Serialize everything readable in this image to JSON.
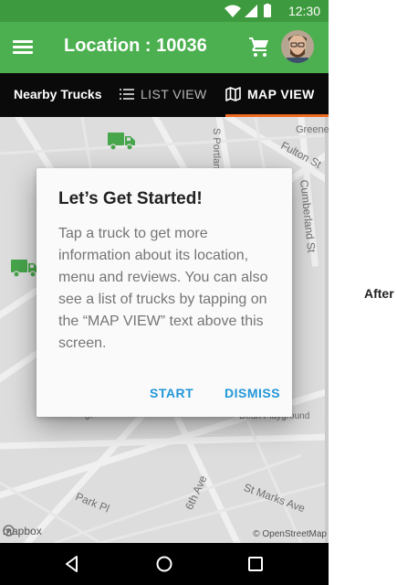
{
  "status": {
    "time": "12:30"
  },
  "appbar": {
    "title": "Location : 10036"
  },
  "tabs": {
    "nearby": "Nearby Trucks",
    "list_view": "LIST VIEW",
    "map_view": "MAP VIEW",
    "active_accent": "#ee6a22"
  },
  "map": {
    "street_labels": [
      "S Portland Ave",
      "Fulton St",
      "Cumberland St",
      "Greene",
      "Park Pl",
      "6th Ave",
      "St Marks Ave",
      "Dean Playground",
      "S"
    ],
    "mapbox": "mapbox",
    "attribution": "© OpenStreetMap"
  },
  "dialog": {
    "title": "Let’s Get Started!",
    "body": "Tap a truck to get more information about its location, menu and reviews. You can also see a list of trucks by tapping on the “MAP VIEW” text above this screen.",
    "start": "START",
    "dismiss": "DISMISS"
  },
  "side_label": "After",
  "colors": {
    "primary": "#4cb050",
    "status": "#3e9a3e",
    "accent_button": "#2196d8"
  }
}
